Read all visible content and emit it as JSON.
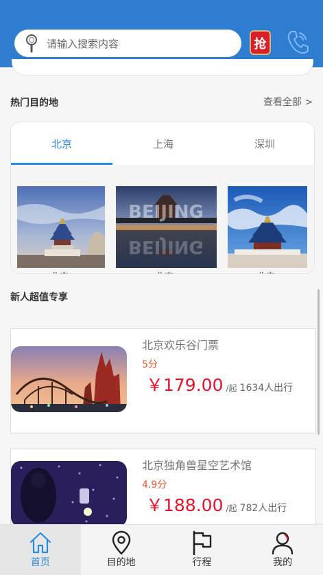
{
  "search": {
    "placeholder": "请输入搜索内容"
  },
  "header_icons": {
    "qiang_label": "抢"
  },
  "hot_destinations": {
    "title": "热门目的地",
    "see_all": "查看全部 >",
    "tabs": [
      "北京",
      "上海",
      "深圳"
    ],
    "active_tab": 0,
    "items": [
      {
        "caption": "北京"
      },
      {
        "caption": "北京"
      },
      {
        "caption": "北京"
      }
    ],
    "watermark_text": "BEIJING"
  },
  "newcomer": {
    "title": "新人超值专享",
    "products": [
      {
        "title": "北京欢乐谷门票",
        "score": "5分",
        "price": "￥179.00",
        "unit": "/起",
        "travelers": "1634人出行"
      },
      {
        "title": "北京独角兽星空艺术馆",
        "score": "4.9分",
        "price": "￥188.00",
        "unit": "/起",
        "travelers": "782人出行"
      }
    ]
  },
  "tabbar": {
    "items": [
      {
        "label": "首页",
        "icon": "home-icon",
        "active": true
      },
      {
        "label": "目的地",
        "icon": "location-pin-icon"
      },
      {
        "label": "行程",
        "icon": "flag-icon"
      },
      {
        "label": "我的",
        "icon": "user-icon"
      }
    ]
  },
  "colors": {
    "header": "#2f7dd0",
    "accent": "#2a8adf",
    "price": "#e4132a",
    "score": "#e4572e"
  }
}
